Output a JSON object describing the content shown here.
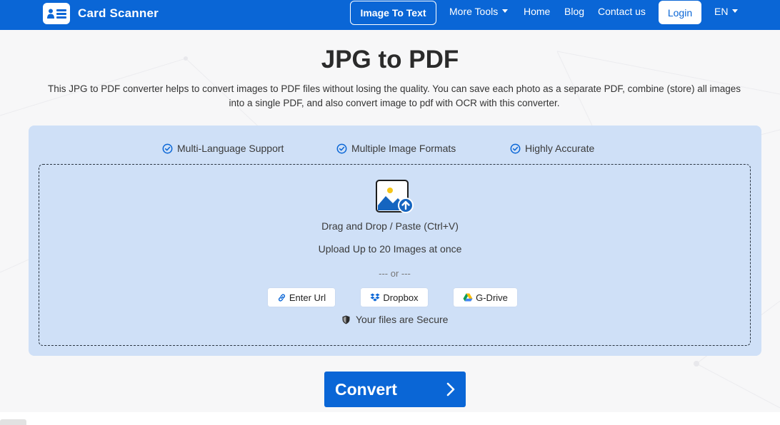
{
  "colors": {
    "primary": "#0a66d6",
    "card_bg": "#cfe0f7",
    "page_bg": "#f7f7f8"
  },
  "nav": {
    "brand": "Card Scanner",
    "image_to_text": "Image To Text",
    "more_tools": "More Tools",
    "home": "Home",
    "blog": "Blog",
    "contact": "Contact us",
    "login": "Login",
    "language": "EN"
  },
  "hero": {
    "title": "JPG to PDF",
    "description": "This JPG to PDF converter helps to convert images to PDF files without losing the quality. You can save each photo as a separate PDF, combine (store) all images into a single PDF, and also convert image to pdf with OCR with this converter."
  },
  "features": [
    {
      "label": "Multi-Language Support",
      "icon": "check-badge-icon"
    },
    {
      "label": "Multiple Image Formats",
      "icon": "check-badge-icon"
    },
    {
      "label": "Highly Accurate",
      "icon": "check-badge-icon"
    }
  ],
  "upload": {
    "drag_text": "Drag and Drop / Paste (Ctrl+V)",
    "limit_text": "Upload Up to 20 Images at once",
    "or_text": "--- or ---",
    "sources": [
      {
        "label": "Enter Url",
        "icon": "link-icon"
      },
      {
        "label": "Dropbox",
        "icon": "dropbox-icon"
      },
      {
        "label": "G-Drive",
        "icon": "google-drive-icon"
      }
    ],
    "secure_text": "Your files are Secure"
  },
  "convert_label": "Convert"
}
